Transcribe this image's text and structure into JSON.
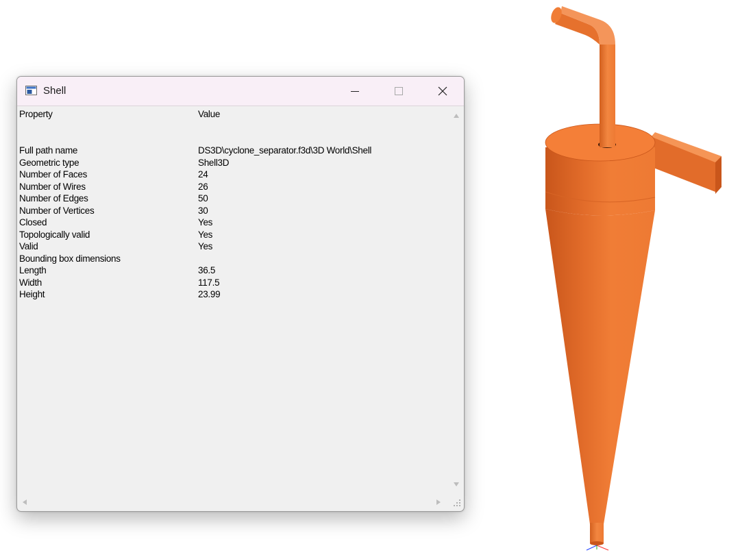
{
  "window": {
    "title": "Shell",
    "icons": [
      "window-app-icon",
      "minimize-icon",
      "maximize-icon",
      "close-icon"
    ]
  },
  "table": {
    "headers": {
      "property": "Property",
      "value": "Value"
    },
    "rows": [
      {
        "property": "Full path name",
        "value": "DS3D\\cyclone_separator.f3d\\3D World\\Shell"
      },
      {
        "property": "Geometric type",
        "value": "Shell3D"
      },
      {
        "property": "Number of Faces",
        "value": "24"
      },
      {
        "property": "Number of Wires",
        "value": "26"
      },
      {
        "property": "Number of Edges",
        "value": "50"
      },
      {
        "property": "Number of Vertices",
        "value": "30"
      },
      {
        "property": "Closed",
        "value": "Yes"
      },
      {
        "property": "Topologically valid",
        "value": "Yes"
      },
      {
        "property": "Valid",
        "value": "Yes"
      },
      {
        "property": "Bounding box dimensions",
        "value": ""
      },
      {
        "property": "Length",
        "value": "36.5"
      },
      {
        "property": "Width",
        "value": "117.5"
      },
      {
        "property": "Height",
        "value": "23.99"
      }
    ]
  },
  "viewport": {
    "object": "cyclone-separator-model",
    "colors": {
      "face": "#ee7d34",
      "shade": "#c9561b",
      "light": "#ffa46b"
    }
  }
}
